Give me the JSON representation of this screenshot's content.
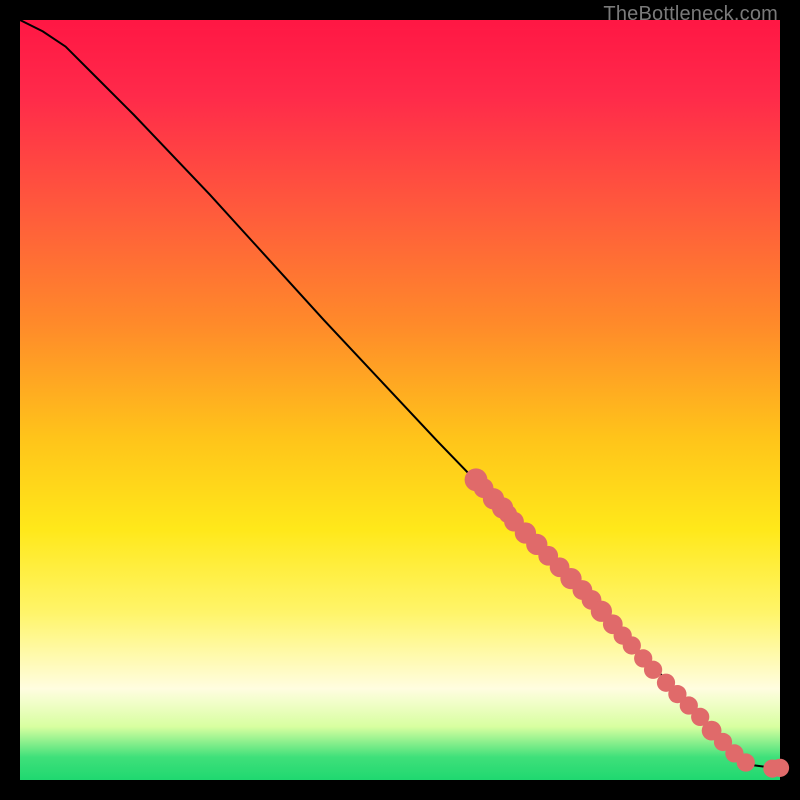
{
  "attribution": "TheBottleneck.com",
  "colors": {
    "point_fill": "#e06a6a",
    "curve_stroke": "#000000",
    "background": "#000000"
  },
  "chart_data": {
    "type": "line",
    "title": "",
    "xlabel": "",
    "ylabel": "",
    "xlim": [
      0,
      100
    ],
    "ylim": [
      0,
      100
    ],
    "curve": [
      {
        "x": 0,
        "y": 100
      },
      {
        "x": 3,
        "y": 98.5
      },
      {
        "x": 6,
        "y": 96.5
      },
      {
        "x": 10,
        "y": 92.5
      },
      {
        "x": 15,
        "y": 87.5
      },
      {
        "x": 25,
        "y": 77
      },
      {
        "x": 40,
        "y": 60.5
      },
      {
        "x": 55,
        "y": 44.5
      },
      {
        "x": 70,
        "y": 29
      },
      {
        "x": 80,
        "y": 18.5
      },
      {
        "x": 88,
        "y": 10
      },
      {
        "x": 93,
        "y": 4.5
      },
      {
        "x": 96,
        "y": 2
      },
      {
        "x": 100,
        "y": 1.5
      }
    ],
    "points": [
      {
        "x": 60.0,
        "y": 39.5,
        "r": 1.5
      },
      {
        "x": 61.0,
        "y": 38.4,
        "r": 1.3
      },
      {
        "x": 62.3,
        "y": 37.0,
        "r": 1.4
      },
      {
        "x": 63.5,
        "y": 35.8,
        "r": 1.4
      },
      {
        "x": 64.2,
        "y": 35.0,
        "r": 1.2
      },
      {
        "x": 65.0,
        "y": 34.0,
        "r": 1.3
      },
      {
        "x": 66.5,
        "y": 32.5,
        "r": 1.4
      },
      {
        "x": 68.0,
        "y": 31.0,
        "r": 1.4
      },
      {
        "x": 69.5,
        "y": 29.5,
        "r": 1.3
      },
      {
        "x": 71.0,
        "y": 28.0,
        "r": 1.3
      },
      {
        "x": 72.5,
        "y": 26.5,
        "r": 1.4
      },
      {
        "x": 74.0,
        "y": 25.0,
        "r": 1.3
      },
      {
        "x": 75.2,
        "y": 23.7,
        "r": 1.3
      },
      {
        "x": 76.5,
        "y": 22.2,
        "r": 1.4
      },
      {
        "x": 78.0,
        "y": 20.5,
        "r": 1.3
      },
      {
        "x": 79.3,
        "y": 19.0,
        "r": 1.2
      },
      {
        "x": 80.5,
        "y": 17.7,
        "r": 1.2
      },
      {
        "x": 82.0,
        "y": 16.0,
        "r": 1.2
      },
      {
        "x": 83.3,
        "y": 14.5,
        "r": 1.2
      },
      {
        "x": 85.0,
        "y": 12.8,
        "r": 1.2
      },
      {
        "x": 86.5,
        "y": 11.3,
        "r": 1.2
      },
      {
        "x": 88.0,
        "y": 9.8,
        "r": 1.2
      },
      {
        "x": 89.5,
        "y": 8.3,
        "r": 1.2
      },
      {
        "x": 91.0,
        "y": 6.5,
        "r": 1.3
      },
      {
        "x": 92.5,
        "y": 5.0,
        "r": 1.2
      },
      {
        "x": 94.0,
        "y": 3.5,
        "r": 1.2
      },
      {
        "x": 95.5,
        "y": 2.3,
        "r": 1.2
      },
      {
        "x": 99.0,
        "y": 1.5,
        "r": 1.2
      },
      {
        "x": 100.0,
        "y": 1.6,
        "r": 1.2
      }
    ]
  }
}
